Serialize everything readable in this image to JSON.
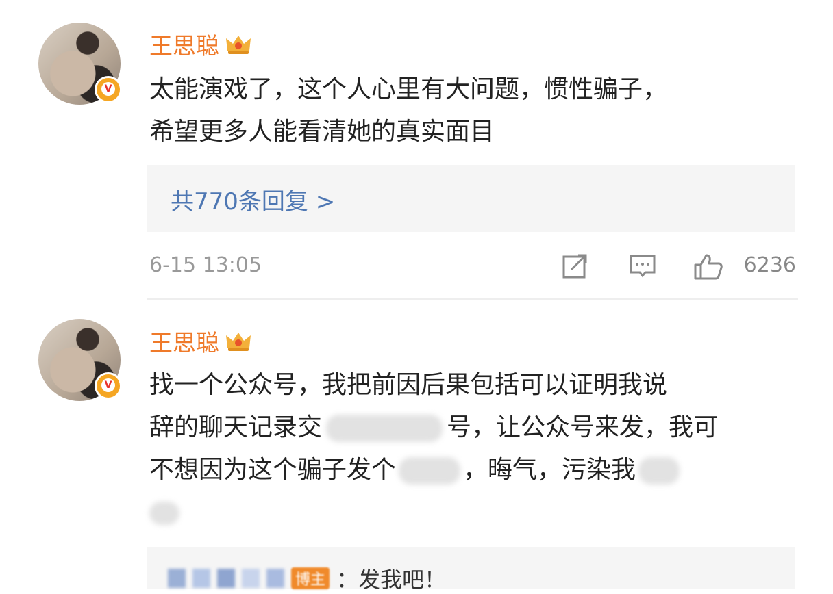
{
  "comments": [
    {
      "username": "王思聪",
      "text_lines": [
        "太能演戏了，这个人心里有大问题，惯性骗子，",
        "希望更多人能看清她的真实面目"
      ],
      "replies_link": "共770条回复 >",
      "timestamp": "6-15 13:05",
      "likes": "6236"
    },
    {
      "username": "王思聪",
      "line1": "找一个公众号，我把前因后果包括可以证明我说",
      "line2_a": "辞的聊天记录交",
      "line2_b": "号，让公众号来发，我可",
      "line3_a": "不想因为这个骗子发个",
      "line3_b": "，晦气，污染我",
      "reply_preview": {
        "tag": "博主",
        "text": "：发我吧！"
      }
    }
  ],
  "icons": [
    "crown-icon",
    "verified-badge-icon",
    "share-icon",
    "comment-icon",
    "like-icon"
  ],
  "colors": {
    "username": "#ef7a2a",
    "link": "#4e77b3",
    "meta": "#999999",
    "reply_bg": "#f5f5f5"
  }
}
